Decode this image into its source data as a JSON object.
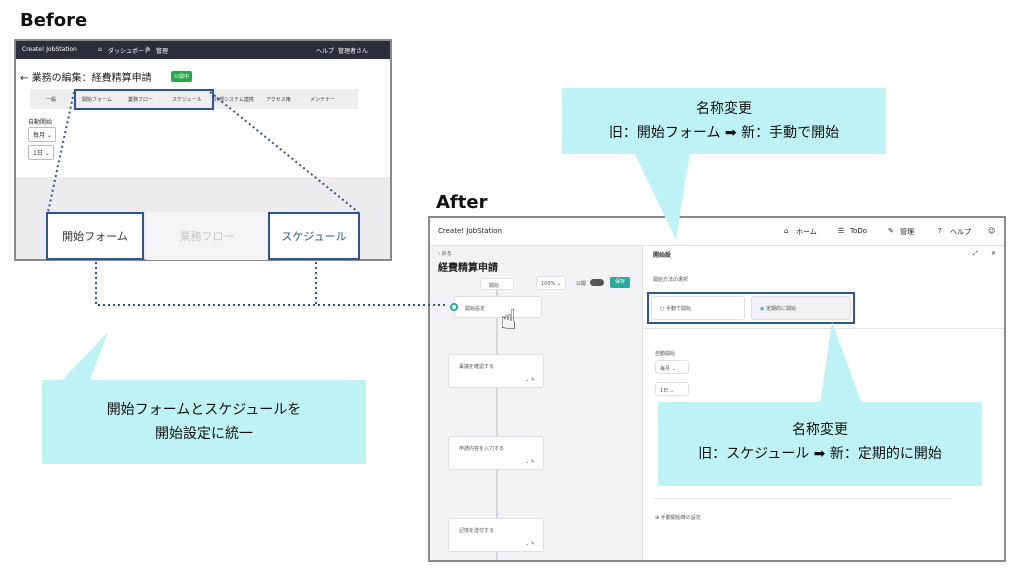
{
  "before": {
    "heading": "Before",
    "brand": "Create! JobStation",
    "nav_dashboard": "ダッシュボード",
    "nav_admin": "管理",
    "help": "ヘルプ",
    "user": "管理者さん",
    "back_arrow": "←",
    "page_title": "業務の編集：経費精算申請",
    "status_badge": "公開中",
    "tabs": [
      "一般",
      "開始フォーム",
      "業務フロー",
      "スケジュール",
      "外部システム連携",
      "アクセス権",
      "メンテナー"
    ],
    "auto_start_label": "自動開始",
    "freq_value": "毎月",
    "day_value": "1日",
    "zoom_tabs": [
      "開始フォーム",
      "業務フロー",
      "スケジュール"
    ]
  },
  "after": {
    "heading": "After",
    "brand": "Create! JobStation",
    "nav": [
      "ホーム",
      "ToDo",
      "管理",
      "ヘルプ"
    ],
    "back_label": "戻る",
    "page_title": "経費精算申請",
    "start_node": "開始",
    "zoom_value": "100%",
    "publish_label": "公開",
    "save_button": "保存",
    "steps": [
      "開始設定",
      "稟議を確認する",
      "申請内容を入力する",
      "記憶を送付する"
    ],
    "panel_title": "開始設",
    "start_method_label": "開始方法の選択",
    "options": [
      "手動で開始",
      "定期的に開始"
    ],
    "auto_start_label": "自動開始",
    "freq_value": "毎月",
    "day_value": "1日",
    "manual_settings_link": "手動開始時の設定"
  },
  "callouts": {
    "top_title": "名称変更",
    "top_detail": "旧：開始フォーム ➡ 新：手動で開始",
    "bottom_left_line1": "開始フォームとスケジュールを",
    "bottom_left_line2": "開始設定に統一",
    "bottom_right_title": "名称変更",
    "bottom_right_detail": "旧：スケジュール ➡ 新：定期的に開始"
  },
  "colors": {
    "callout_bg": "#bff2f5",
    "highlight_border": "#2f5597",
    "topbar_dark": "#2c2e3c",
    "badge_green": "#2aa74a",
    "teal": "#2aa89a"
  }
}
